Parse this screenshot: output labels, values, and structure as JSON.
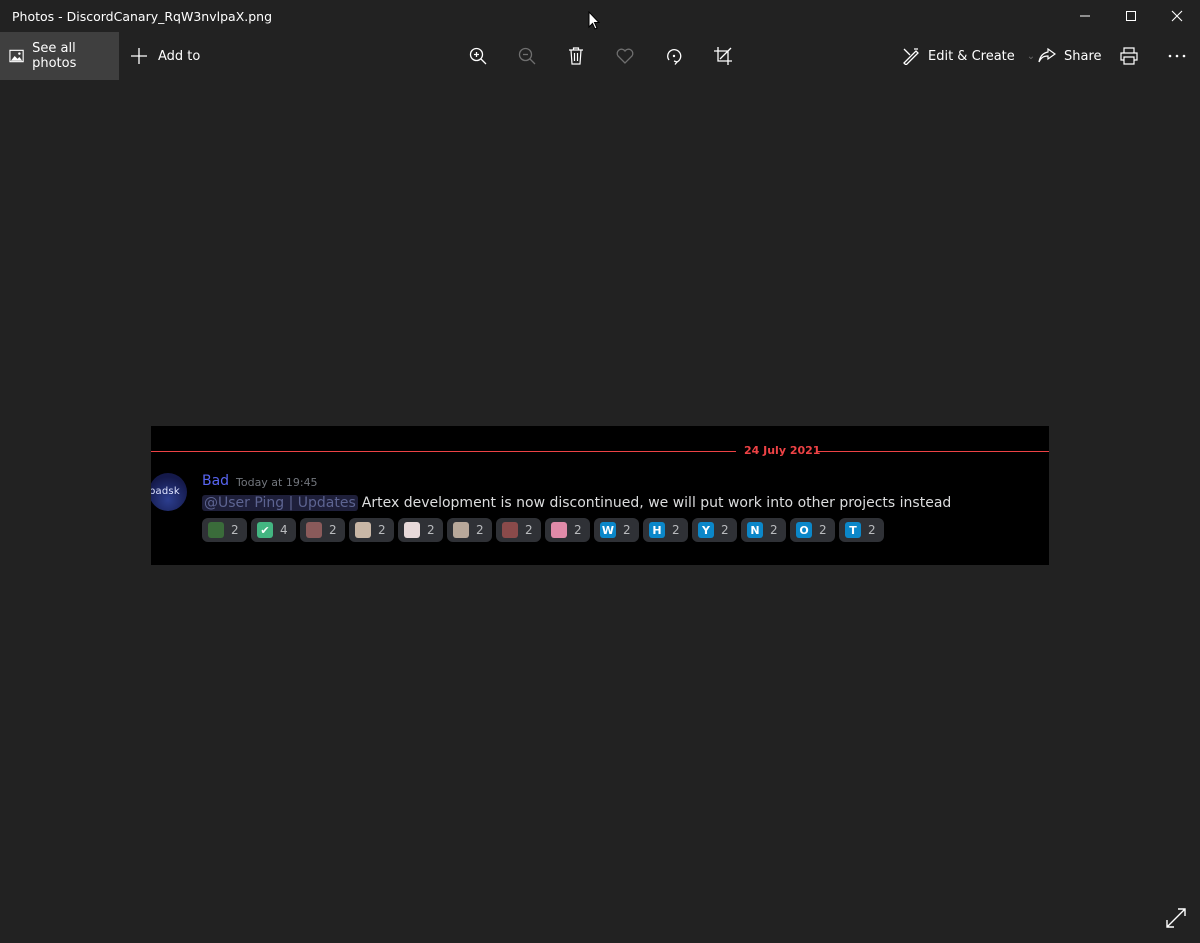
{
  "window": {
    "title": "Photos - DiscordCanary_RqW3nvlpaX.png",
    "minimize_icon": "minimize-icon",
    "maximize_icon": "maximize-icon",
    "close_icon": "close-icon"
  },
  "toolbar": {
    "see_all_label": "See all photos",
    "add_to_label": "Add to",
    "edit_create_label": "Edit & Create",
    "share_label": "Share",
    "icons": [
      "zoom-in-icon",
      "zoom-out-icon",
      "delete-icon",
      "favorite-icon",
      "rotate-icon",
      "crop-icon",
      "print-icon",
      "more-icon"
    ]
  },
  "image": {
    "date_divider": "24 July 2021",
    "avatar_text": "badsk",
    "username": "Bad",
    "timestamp": "Today at 19:45",
    "mention": "@User Ping | Updates",
    "message": "Artex development is now discontinued, we will put work into other projects instead",
    "reactions": [
      {
        "emoji": "",
        "count": "2",
        "color": "#3a6b3a"
      },
      {
        "emoji": "✔",
        "count": "4",
        "color": "#43b581"
      },
      {
        "emoji": "",
        "count": "2",
        "color": "#8a5a5a"
      },
      {
        "emoji": "",
        "count": "2",
        "color": "#c9b7a6"
      },
      {
        "emoji": "",
        "count": "2",
        "color": "#e8dada"
      },
      {
        "emoji": "",
        "count": "2",
        "color": "#b8a89a"
      },
      {
        "emoji": "",
        "count": "2",
        "color": "#8a4a4a"
      },
      {
        "emoji": "",
        "count": "2",
        "color": "#e08aa8"
      },
      {
        "emoji": "W",
        "count": "2",
        "color": "#0b87c9"
      },
      {
        "emoji": "H",
        "count": "2",
        "color": "#0b87c9"
      },
      {
        "emoji": "Y",
        "count": "2",
        "color": "#0b87c9"
      },
      {
        "emoji": "N",
        "count": "2",
        "color": "#0b87c9"
      },
      {
        "emoji": "O",
        "count": "2",
        "color": "#0b87c9"
      },
      {
        "emoji": "T",
        "count": "2",
        "color": "#0b87c9"
      }
    ]
  },
  "colors": {
    "background": "#222222",
    "toolbar_active": "#3f3f3f",
    "discord_red": "#ed4245",
    "discord_blurple": "#5865f2"
  }
}
